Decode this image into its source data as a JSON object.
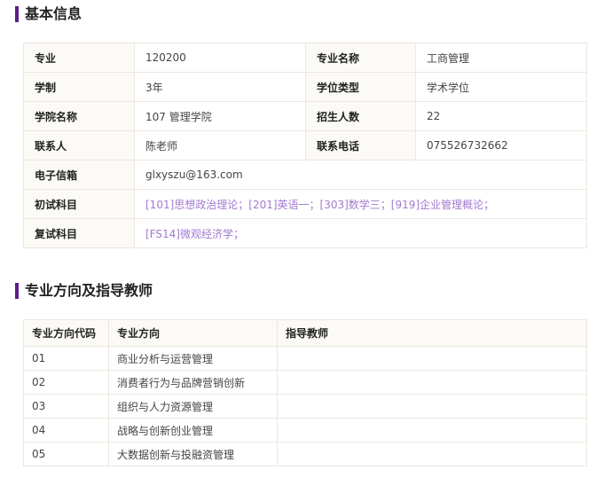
{
  "basic_info": {
    "title": "基本信息",
    "rows": [
      {
        "l1": "专业",
        "v1": "120200",
        "l2": "专业名称",
        "v2": "工商管理"
      },
      {
        "l1": "学制",
        "v1": "3年",
        "l2": "学位类型",
        "v2": "学术学位"
      },
      {
        "l1": "学院名称",
        "v1": "107 管理学院",
        "l2": "招生人数",
        "v2": "22"
      },
      {
        "l1": "联系人",
        "v1": "陈老师",
        "l2": "联系电话",
        "v2": "075526732662"
      }
    ],
    "email_label": "电子信箱",
    "email_value": "glxyszu@163.com",
    "initial_label": "初试科目",
    "initial_value": "[101]思想政治理论；[201]英语一；[303]数学三；[919]企业管理概论；",
    "retest_label": "复试科目",
    "retest_value": "[FS14]微观经济学；"
  },
  "directions": {
    "title": "专业方向及指导教师",
    "headers": {
      "code": "专业方向代码",
      "direction": "专业方向",
      "advisor": "指导教师"
    },
    "rows": [
      {
        "code": "01",
        "direction": "商业分析与运营管理",
        "advisor": ""
      },
      {
        "code": "02",
        "direction": "消费者行为与品牌营销创新",
        "advisor": ""
      },
      {
        "code": "03",
        "direction": "组织与人力资源管理",
        "advisor": ""
      },
      {
        "code": "04",
        "direction": "战略与创新创业管理",
        "advisor": ""
      },
      {
        "code": "05",
        "direction": "大数据创新与投融资管理",
        "advisor": ""
      }
    ]
  },
  "colors": {
    "accent_bar": "#5a1f86",
    "subject_link": "#a27ad0",
    "label_bg": "#fcfaf6",
    "border": "#ece7de"
  }
}
